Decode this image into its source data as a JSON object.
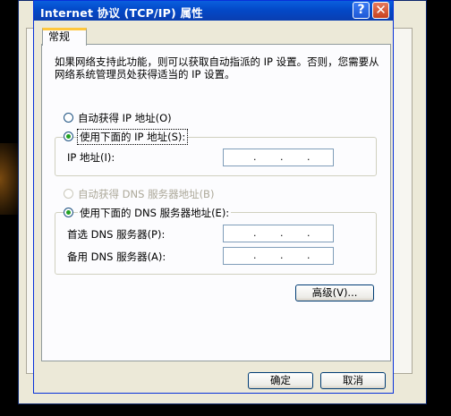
{
  "dialog": {
    "title": "Internet 协议 (TCP/IP) 属性",
    "help_label": "?",
    "close_label": "✕"
  },
  "tab": {
    "label": "常规"
  },
  "description": "如果网络支持此功能，则可以获取自动指派的 IP 设置。否则，您需要从网络系统管理员处获得适当的 IP 设置。",
  "ip_section": {
    "auto_label": "自动获得 IP 地址(O)",
    "manual_label": "使用下面的 IP 地址(S):",
    "ip_address_label": "IP 地址(I):",
    "ip_address_value": "  .  .  ."
  },
  "dns_section": {
    "auto_label": "自动获得 DNS 服务器地址(B)",
    "manual_label": "使用下面的 DNS 服务器地址(E):",
    "preferred_label": "首选 DNS 服务器(P):",
    "alternate_label": "备用 DNS 服务器(A):"
  },
  "buttons": {
    "advanced_label": "高级(V)...",
    "ok_label": "确定",
    "cancel_label": "取消"
  },
  "ip_dot": "."
}
